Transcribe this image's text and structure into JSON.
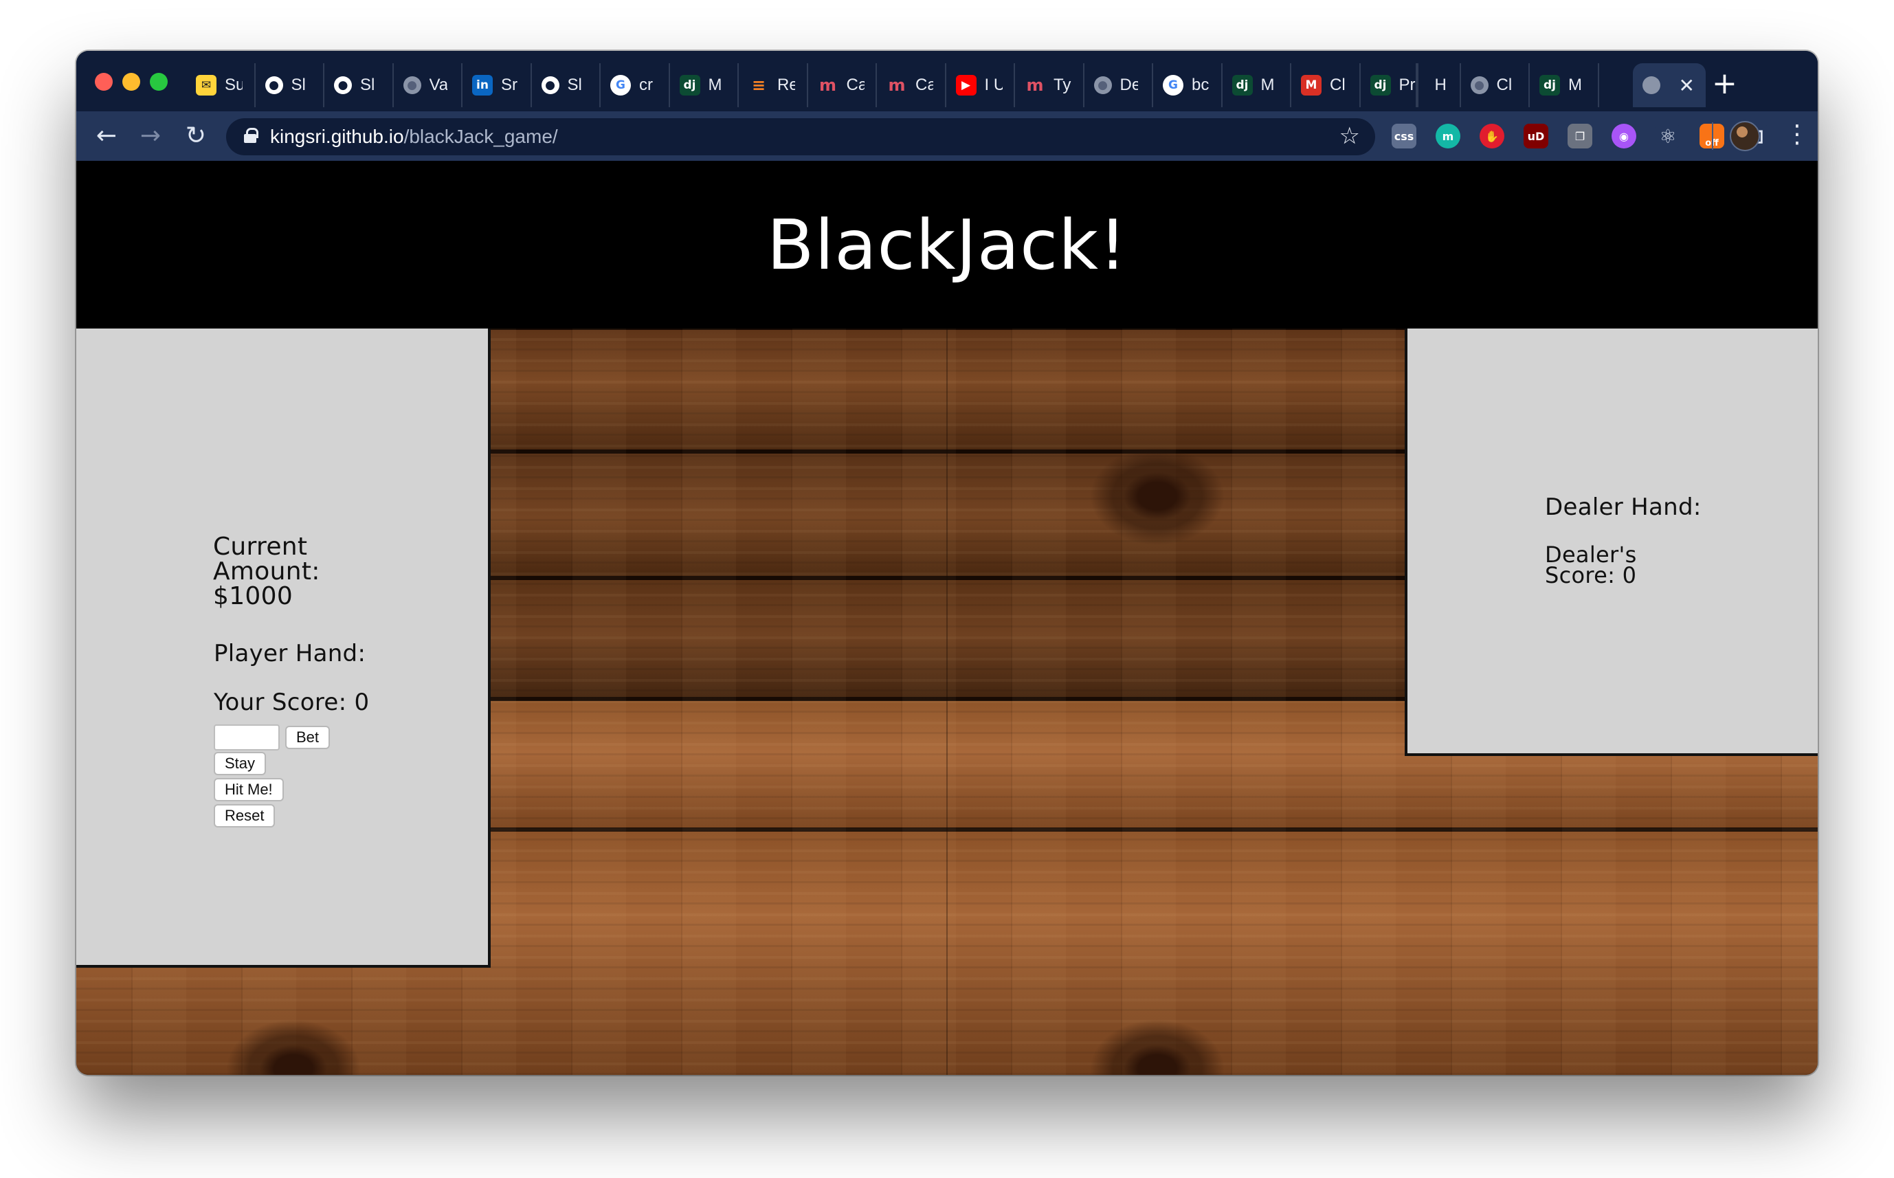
{
  "browser": {
    "tabs": [
      {
        "label": "Su",
        "icon": "mailchimp-icon",
        "color": "#ffd43b",
        "glyph": "✉"
      },
      {
        "label": "Sl",
        "icon": "github-icon",
        "color": "#ffffff",
        "glyph": "●"
      },
      {
        "label": "Sl",
        "icon": "github-icon",
        "color": "#ffffff",
        "glyph": "●"
      },
      {
        "label": "Va",
        "icon": "globe-icon",
        "color": "#8a94a8",
        "glyph": "●"
      },
      {
        "label": "Sr",
        "icon": "linkedin-icon",
        "color": "#0a66c2",
        "glyph": "in"
      },
      {
        "label": "Sl",
        "icon": "github-icon",
        "color": "#ffffff",
        "glyph": "●"
      },
      {
        "label": "cr",
        "icon": "google-icon",
        "color": "#ffffff",
        "glyph": "G"
      },
      {
        "label": "M",
        "icon": "django-icon",
        "color": "#0c4b33",
        "glyph": "dj"
      },
      {
        "label": "Re",
        "icon": "stackoverflow-icon",
        "color": "#f48024",
        "glyph": "≡"
      },
      {
        "label": "Ca",
        "icon": "medium-icon",
        "color": "#e05264",
        "glyph": "m"
      },
      {
        "label": "Ca",
        "icon": "medium-icon",
        "color": "#e05264",
        "glyph": "m"
      },
      {
        "label": "I U",
        "icon": "youtube-icon",
        "color": "#ff0000",
        "glyph": "▶"
      },
      {
        "label": "Ty",
        "icon": "medium-icon",
        "color": "#e05264",
        "glyph": "m"
      },
      {
        "label": "De",
        "icon": "globe-icon",
        "color": "#8a94a8",
        "glyph": "●"
      },
      {
        "label": "bc",
        "icon": "google-icon",
        "color": "#ffffff",
        "glyph": "G"
      },
      {
        "label": "M",
        "icon": "django-icon",
        "color": "#0c4b33",
        "glyph": "dj"
      },
      {
        "label": "Cl",
        "icon": "gmail-icon",
        "color": "#d93025",
        "glyph": "M"
      },
      {
        "label": "Pr",
        "icon": "django-icon",
        "color": "#0c4b33",
        "glyph": "dj"
      },
      {
        "label": "H",
        "icon": "blank-icon",
        "color": "transparent",
        "glyph": ""
      },
      {
        "label": "Cl",
        "icon": "globe-icon",
        "color": "#8a94a8",
        "glyph": "●"
      },
      {
        "label": "M",
        "icon": "django-icon",
        "color": "#0c4b33",
        "glyph": "dj"
      }
    ],
    "active_tab": {
      "icon": "globe-icon",
      "close_glyph": "✕"
    },
    "new_tab_glyph": "+",
    "url_host": "kingsri.github.io",
    "url_path": "/blackJack_game/",
    "extensions": [
      {
        "name": "css-extension-icon",
        "color": "#5f6f8f",
        "glyph": "css"
      },
      {
        "name": "mentor-extension-icon",
        "color": "#14b8a6",
        "glyph": "m"
      },
      {
        "name": "stop-hand-extension-icon",
        "color": "#e11d2e",
        "glyph": "✋"
      },
      {
        "name": "ublock-extension-icon",
        "color": "#800000",
        "glyph": "uD"
      },
      {
        "name": "copy-extension-icon",
        "color": "#6b7280",
        "glyph": "❐"
      },
      {
        "name": "colorzilla-extension-icon",
        "color": "#a855f7",
        "glyph": "◉"
      },
      {
        "name": "react-devtools-icon",
        "color": "#24365a",
        "glyph": "⚛"
      },
      {
        "name": "rss-off-extension-icon",
        "color": "#f97316",
        "glyph": "off"
      },
      {
        "name": "grid-extension-icon",
        "color": "#24365a",
        "glyph": "⊞"
      }
    ]
  },
  "page": {
    "title": "BlackJack!",
    "player": {
      "amount_line1": "Current",
      "amount_line2": "Amount:",
      "amount_value": "$1000",
      "hand_label": "Player Hand:",
      "score_text": "Your Score: 0",
      "bet_input_value": "",
      "bet_label": "Bet",
      "stay_label": "Stay",
      "hit_label": "Hit Me!",
      "reset_label": "Reset"
    },
    "dealer": {
      "hand_label": "Dealer Hand:",
      "score_line1": "Dealer's",
      "score_line2": "Score: 0"
    }
  }
}
